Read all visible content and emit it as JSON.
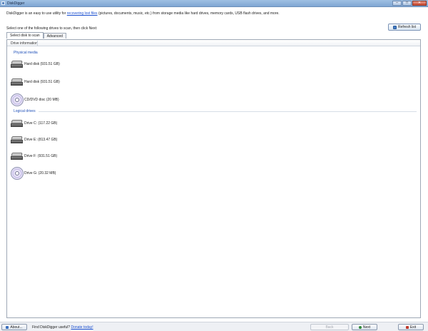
{
  "window": {
    "title": "DiskDigger",
    "controls": [
      "–",
      "□",
      "✕"
    ]
  },
  "intro": {
    "before_link": "DiskDigger is an easy to use utility for ",
    "link": "recovering lost files",
    "after_link": " (pictures, documents, music, etc.) from storage media like hard drives, memory cards, USB flash drives, and more."
  },
  "hint": "Select one of the following drives to scan, then click Next:",
  "refresh_label": "Refresh list",
  "tabs": [
    {
      "label": "Select disk to scan",
      "active": true
    },
    {
      "label": "Advanced",
      "active": false
    }
  ],
  "column_header": "Drive information",
  "groups": {
    "physical": {
      "label": "Physical media",
      "drives": [
        {
          "label": "Hard disk (931.51 GB)",
          "icon": "hdd-icon"
        },
        {
          "label": "Hard disk (931.51 GB)",
          "icon": "hdd-icon"
        },
        {
          "label": "CD/DVD disc (20 MB)",
          "icon": "cd-icon"
        }
      ]
    },
    "logical": {
      "label": "Logical drives",
      "drives": [
        {
          "label": "Drive C: (117.22 GB)",
          "icon": "hdd-icon"
        },
        {
          "label": "Drive E: (813.47 GB)",
          "icon": "hdd-icon"
        },
        {
          "label": "Drive F: (931.51 GB)",
          "icon": "hdd-icon"
        },
        {
          "label": "Drive G: (20.32 MB)",
          "icon": "cd-icon"
        }
      ]
    }
  },
  "footer": {
    "about_label": "About...",
    "text": "Find DiskDigger useful? ",
    "link": "Donate today!",
    "back_label": "Back",
    "next_label": "Next",
    "exit_label": "Exit"
  },
  "colors": {
    "link": "#1a4fd0",
    "group_label": "#1e4fb8",
    "titlebar": "#8fb3dc"
  }
}
